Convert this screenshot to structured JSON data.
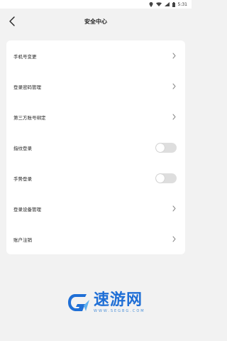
{
  "status_bar": {
    "time": "5:31"
  },
  "header": {
    "title": "安全中心"
  },
  "items": [
    {
      "label": "手机号变更",
      "control": "chevron"
    },
    {
      "label": "登录密码管理",
      "control": "chevron"
    },
    {
      "label": "第三方账号绑定",
      "control": "chevron"
    },
    {
      "label": "指纹登录",
      "control": "toggle",
      "enabled": false
    },
    {
      "label": "手势登录",
      "control": "toggle",
      "enabled": false
    },
    {
      "label": "登录设备管理",
      "control": "chevron"
    },
    {
      "label": "账户注销",
      "control": "chevron"
    }
  ],
  "watermark": {
    "brand": "速游网",
    "url": "WWW.SEGBG.COM"
  },
  "colors": {
    "accent": "#1f6fd6",
    "toggle_off": "#dedede",
    "background": "#f2f2f2"
  }
}
